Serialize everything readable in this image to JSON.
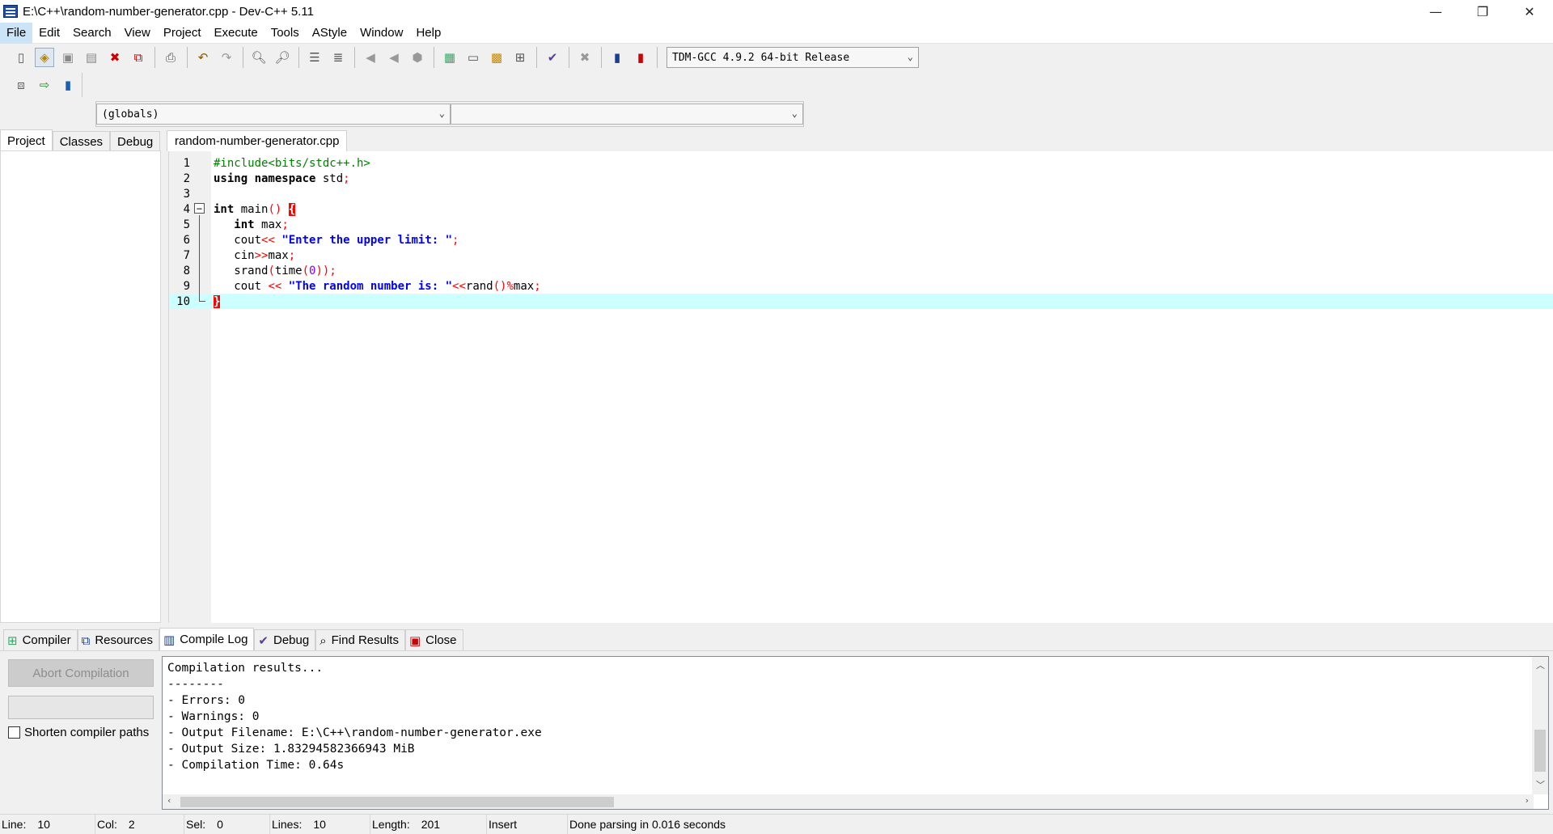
{
  "window": {
    "title": "E:\\C++\\random-number-generator.cpp - Dev-C++ 5.11",
    "minimize": "—",
    "restore": "❐",
    "close": "✕"
  },
  "menu": [
    "File",
    "Edit",
    "Search",
    "View",
    "Project",
    "Execute",
    "Tools",
    "AStyle",
    "Window",
    "Help"
  ],
  "toolbar": {
    "compiler": "TDM-GCC 4.9.2 64-bit Release"
  },
  "scope": {
    "class_value": "(globals)",
    "member_value": ""
  },
  "left_tabs": [
    "Project",
    "Classes",
    "Debug"
  ],
  "editor": {
    "tab_label": "random-number-generator.cpp",
    "line_numbers": [
      "1",
      "2",
      "3",
      "4",
      "5",
      "6",
      "7",
      "8",
      "9",
      "10"
    ],
    "current_line": 10
  },
  "bottom_tabs": [
    "Compiler",
    "Resources",
    "Compile Log",
    "Debug",
    "Find Results",
    "Close"
  ],
  "compile_panel": {
    "abort_label": "Abort Compilation",
    "shorten_label": "Shorten compiler paths",
    "log": [
      "Compilation results...",
      "--------",
      "- Errors: 0",
      "- Warnings: 0",
      "- Output Filename: E:\\C++\\random-number-generator.exe",
      "- Output Size: 1.83294582366943 MiB",
      "- Compilation Time: 0.64s"
    ]
  },
  "status": {
    "line_label": "Line:",
    "line_value": "10",
    "col_label": "Col:",
    "col_value": "2",
    "sel_label": "Sel:",
    "sel_value": "0",
    "lines_label": "Lines:",
    "lines_value": "10",
    "length_label": "Length:",
    "length_value": "201",
    "mode": "Insert",
    "message": "Done parsing in 0.016 seconds"
  },
  "colors": {
    "current_line": "#ccffff",
    "brace_highlight": "#ff0000",
    "string": "#0000ff",
    "preprocessor": "#008000",
    "symbol": "#ff0000"
  }
}
